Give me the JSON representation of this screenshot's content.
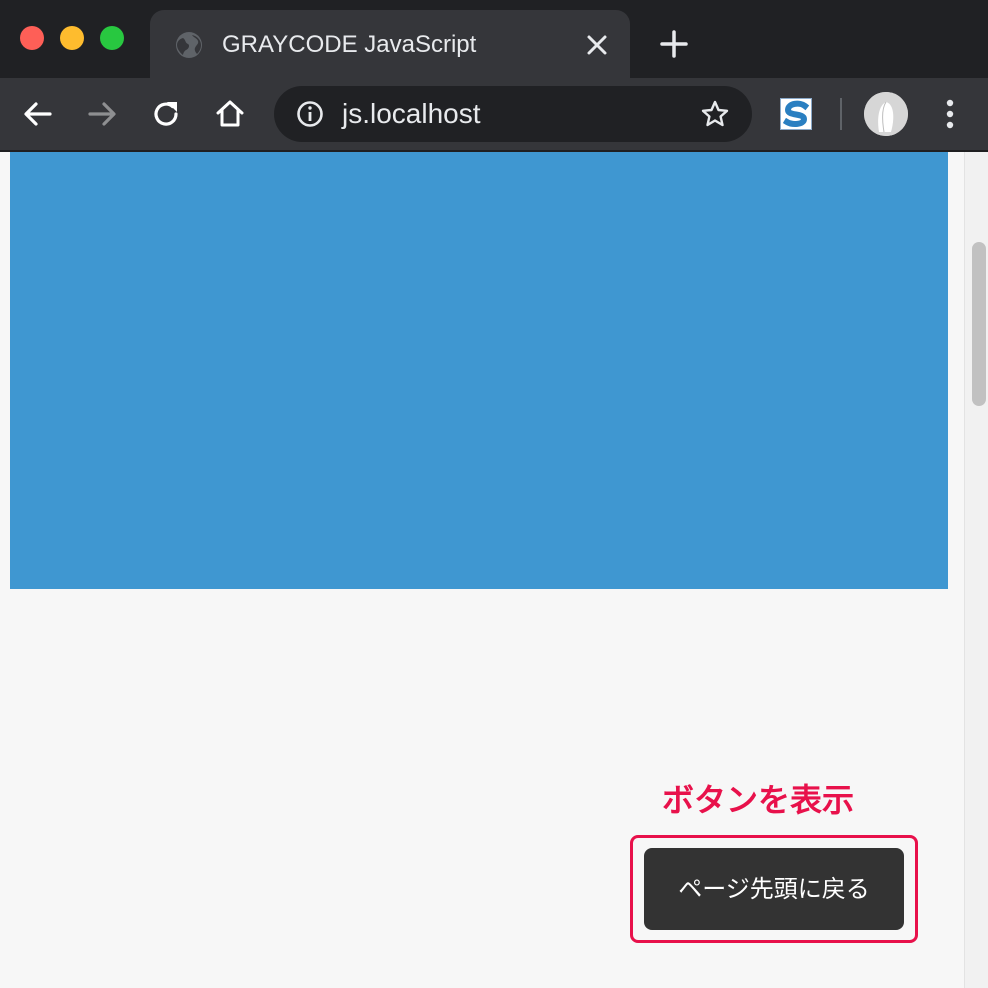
{
  "window": {
    "controls": [
      "close",
      "minimize",
      "zoom"
    ]
  },
  "tab": {
    "title": "GRAYCODE JavaScript",
    "favicon": "globe-icon",
    "close_icon": "close-icon"
  },
  "toolbar": {
    "back_icon": "arrow-left-icon",
    "forward_icon": "arrow-right-icon",
    "reload_icon": "reload-icon",
    "home_icon": "home-icon",
    "url": "js.localhost",
    "site_info_icon": "info-icon",
    "bookmark_icon": "star-icon",
    "extension_icon": "s-logo-icon",
    "menu_icon": "kebab-menu-icon"
  },
  "page": {
    "box_color": "#3f97d1",
    "annotation_label": "ボタンを表示",
    "annotation_color": "#e8114b",
    "back_to_top_label": "ページ先頭に戻る"
  },
  "colors": {
    "tabstrip": "#202124",
    "toolbar": "#35363a",
    "button_bg": "#333333"
  }
}
